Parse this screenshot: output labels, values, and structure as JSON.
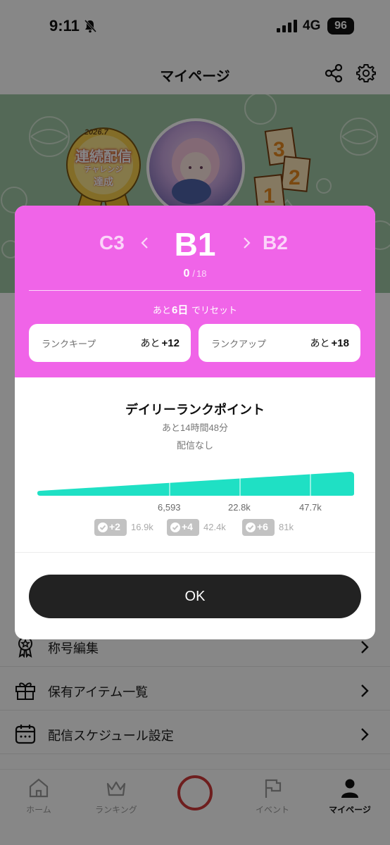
{
  "status_bar": {
    "time": "9:11",
    "network": "4G",
    "battery": "96"
  },
  "header": {
    "title": "マイページ"
  },
  "banner": {
    "badge_year": "2026.7",
    "badge_line1": "連続配信",
    "badge_line2": "チャレンジ",
    "badge_line3": "達成"
  },
  "menu": [
    {
      "label": "称号編集",
      "icon": "award-icon"
    },
    {
      "label": "保有アイテム一覧",
      "icon": "gift-icon"
    },
    {
      "label": "配信スケジュール設定",
      "icon": "calendar-icon"
    }
  ],
  "tabs": [
    {
      "label": "ホーム",
      "icon": "home-icon",
      "active": false
    },
    {
      "label": "ランキング",
      "icon": "crown-icon",
      "active": false
    },
    {
      "label": "",
      "icon": "live-button",
      "active": false
    },
    {
      "label": "イベント",
      "icon": "flag-icon",
      "active": false
    },
    {
      "label": "マイページ",
      "icon": "user-icon",
      "active": true
    }
  ],
  "modal": {
    "rank_prev": "C3",
    "rank_current": "B1",
    "rank_next": "B2",
    "points_current": "0",
    "points_separator": "/",
    "points_total": "18",
    "reset_prefix": "あと",
    "reset_days": "6日",
    "reset_suffix": "でリセット",
    "keep_card": {
      "label": "ランクキープ",
      "prefix": "あと",
      "value": "+12"
    },
    "up_card": {
      "label": "ランクアップ",
      "prefix": "あと",
      "value": "+18"
    },
    "daily_title": "デイリーランクポイント",
    "daily_remaining": "あと14時間48分",
    "daily_status": "配信なし",
    "progress_fraction": 0,
    "progress_color": "#1fe0c4",
    "tick_labels": [
      "6,593",
      "22.8k",
      "47.7k"
    ],
    "rewards": [
      {
        "points": "+2",
        "threshold": "16.9k"
      },
      {
        "points": "+4",
        "threshold": "42.4k"
      },
      {
        "points": "+6",
        "threshold": "81k"
      }
    ],
    "ok_label": "OK",
    "accent_color": "#f064e8"
  }
}
